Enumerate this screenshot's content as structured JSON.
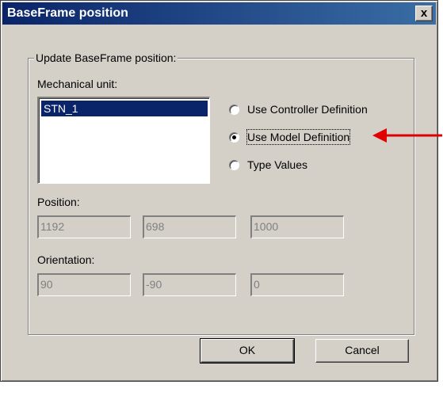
{
  "window": {
    "title": "BaseFrame position",
    "close_label": "x"
  },
  "group": {
    "legend": "Update BaseFrame position:"
  },
  "mechanical_unit": {
    "label": "Mechanical unit:",
    "items": [
      "STN_1"
    ]
  },
  "options": [
    {
      "label": "Use Controller Definition",
      "checked": false
    },
    {
      "label": "Use Model Definition",
      "checked": true
    },
    {
      "label": "Type Values",
      "checked": false
    }
  ],
  "position": {
    "label": "Position:",
    "values": [
      "1192",
      "698",
      "1000"
    ]
  },
  "orientation": {
    "label": "Orientation:",
    "values": [
      "90",
      "-90",
      "0"
    ]
  },
  "buttons": {
    "ok": "OK",
    "cancel": "Cancel"
  },
  "colors": {
    "titlebar": "#0a246a",
    "annotation_arrow": "#e00000",
    "dialog_bg": "#d4d0c8"
  },
  "icons": {
    "annotation": "red-arrow-icon"
  }
}
